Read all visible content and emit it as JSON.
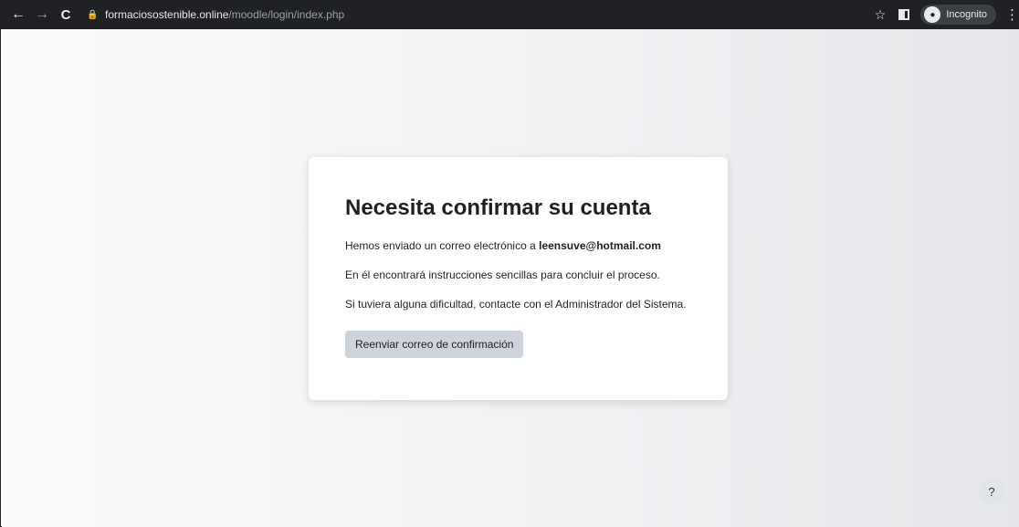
{
  "browser": {
    "url_host": "formaciosostenible.online",
    "url_path": "/moodle/login/index.php",
    "incognito_label": "Incognito"
  },
  "card": {
    "title": "Necesita confirmar su cuenta",
    "line1_prefix": "Hemos enviado un correo electrónico a ",
    "email": "leensuve@hotmail.com",
    "line2": "En él encontrará instrucciones sencillas para concluir el proceso.",
    "line3": "Si tuviera alguna dificultad, contacte con el Administrador del Sistema.",
    "resend_button": "Reenviar correo de confirmación"
  },
  "help_label": "?"
}
